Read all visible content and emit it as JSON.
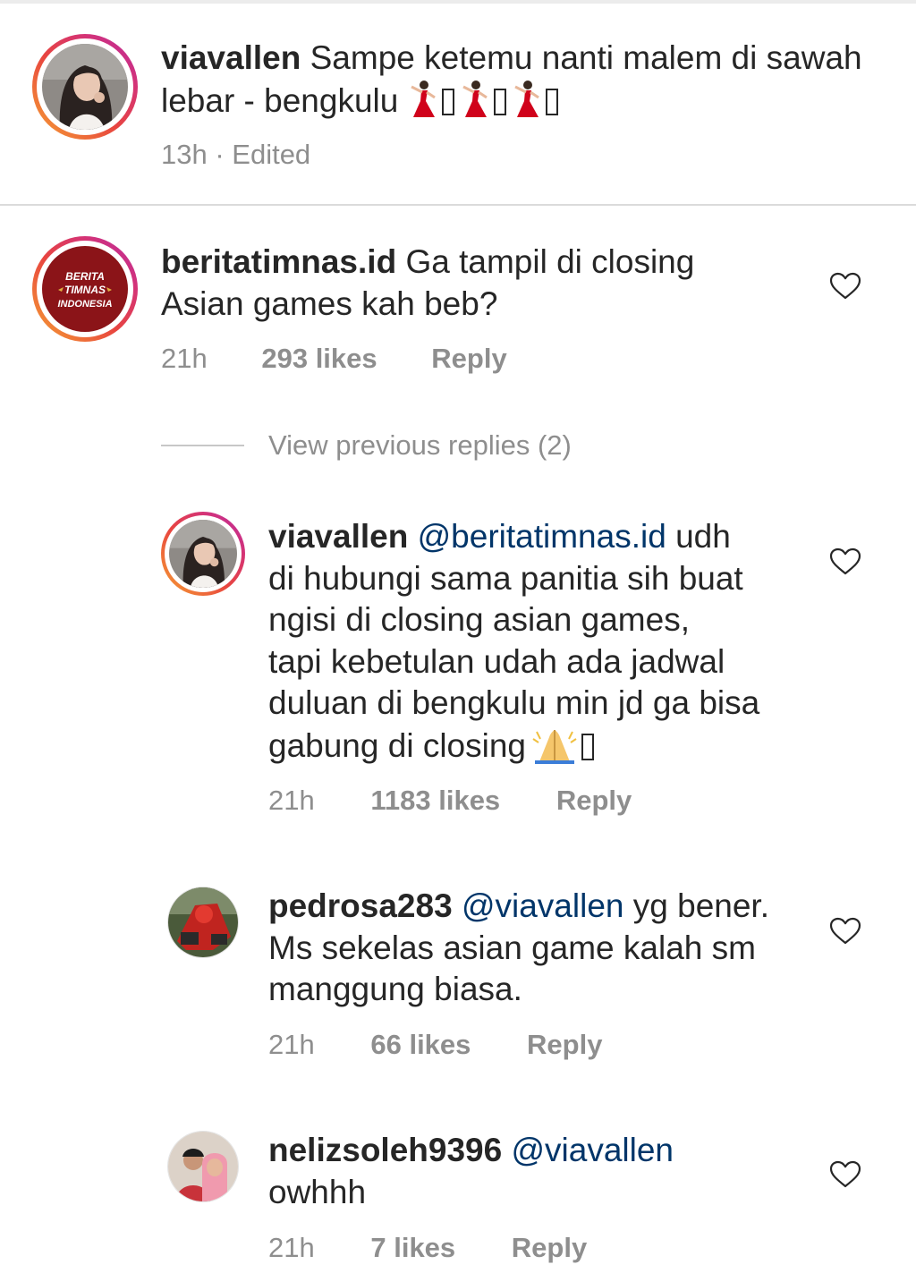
{
  "caption": {
    "username": "viavallen",
    "text": "Sampe ketemu nanti malem di sawah lebar - bengkulu",
    "emoji_sequence": [
      "dancer-emoji",
      "missing-glyph",
      "dancer-emoji",
      "missing-glyph",
      "dancer-emoji",
      "missing-glyph"
    ],
    "meta": "13h · Edited"
  },
  "comments": [
    {
      "username": "beritatimnas.id",
      "mention": "",
      "text": "Ga tampil di closing",
      "text2": "Asian games kah beb?",
      "time": "21h",
      "likes": "293 likes",
      "reply": "Reply",
      "avatar_text": [
        "BERITA",
        "TIMNAS",
        "INDONESIA"
      ]
    }
  ],
  "view_previous": "View previous replies (2)",
  "replies": [
    {
      "username": "viavallen",
      "mention": "@beritatimnas.id",
      "line1_rest": "udh",
      "lines": [
        "di hubungi sama panitia sih buat",
        "ngisi di closing asian games,",
        "tapi kebetulan udah ada jadwal",
        "duluan di bengkulu min jd ga bisa",
        "gabung di closing"
      ],
      "trailing_emoji": [
        "folded-hands-emoji",
        "missing-glyph"
      ],
      "time": "21h",
      "likes": "1183 likes",
      "reply": "Reply"
    },
    {
      "username": "pedrosa283",
      "mention": "@viavallen",
      "line1_rest": "yg bener.",
      "lines": [
        "Ms sekelas asian game kalah sm",
        "manggung biasa."
      ],
      "time": "21h",
      "likes": "66 likes",
      "reply": "Reply"
    },
    {
      "username": "nelizsoleh9396",
      "mention": "@viavallen",
      "line1_rest": "",
      "lines": [
        "owhhh"
      ],
      "time": "21h",
      "likes": "7 likes",
      "reply": "Reply"
    }
  ],
  "colors": {
    "text": "#262626",
    "meta": "#8e8e8e",
    "mention": "#003569",
    "divider": "#dbdbdb",
    "ring_start": "#f6a333",
    "ring_end": "#b82aa3",
    "timnas_red": "#8b1418"
  },
  "icons": {
    "like": "heart-outline-icon"
  }
}
